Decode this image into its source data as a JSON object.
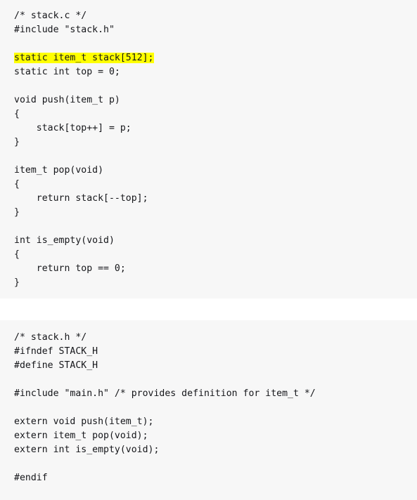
{
  "colors": {
    "page_background": "#ffffff",
    "code_block_background": "#f7f7f7",
    "text": "#15161a",
    "highlight": "#ffff00"
  },
  "blocks": [
    {
      "name": "stack-c",
      "lines": [
        {
          "text": "/* stack.c */",
          "highlight": false
        },
        {
          "text": "#include \"stack.h\"",
          "highlight": false
        },
        {
          "text": "",
          "highlight": false
        },
        {
          "text": "static item_t stack[512];",
          "highlight": true
        },
        {
          "text": "static int top = 0;",
          "highlight": false
        },
        {
          "text": "",
          "highlight": false
        },
        {
          "text": "void push(item_t p)",
          "highlight": false
        },
        {
          "text": "{",
          "highlight": false
        },
        {
          "text": "    stack[top++] = p;",
          "highlight": false
        },
        {
          "text": "}",
          "highlight": false
        },
        {
          "text": "",
          "highlight": false
        },
        {
          "text": "item_t pop(void)",
          "highlight": false
        },
        {
          "text": "{",
          "highlight": false
        },
        {
          "text": "    return stack[--top];",
          "highlight": false
        },
        {
          "text": "}",
          "highlight": false
        },
        {
          "text": "",
          "highlight": false
        },
        {
          "text": "int is_empty(void)",
          "highlight": false
        },
        {
          "text": "{",
          "highlight": false
        },
        {
          "text": "    return top == 0;",
          "highlight": false
        },
        {
          "text": "}",
          "highlight": false
        }
      ]
    },
    {
      "name": "stack-h",
      "lines": [
        {
          "text": "/* stack.h */",
          "highlight": false
        },
        {
          "text": "#ifndef STACK_H",
          "highlight": false
        },
        {
          "text": "#define STACK_H",
          "highlight": false
        },
        {
          "text": "",
          "highlight": false
        },
        {
          "text": "#include \"main.h\" /* provides definition for item_t */",
          "highlight": false
        },
        {
          "text": "",
          "highlight": false
        },
        {
          "text": "extern void push(item_t);",
          "highlight": false
        },
        {
          "text": "extern item_t pop(void);",
          "highlight": false
        },
        {
          "text": "extern int is_empty(void);",
          "highlight": false
        },
        {
          "text": "",
          "highlight": false
        },
        {
          "text": "#endif",
          "highlight": false
        }
      ]
    }
  ]
}
